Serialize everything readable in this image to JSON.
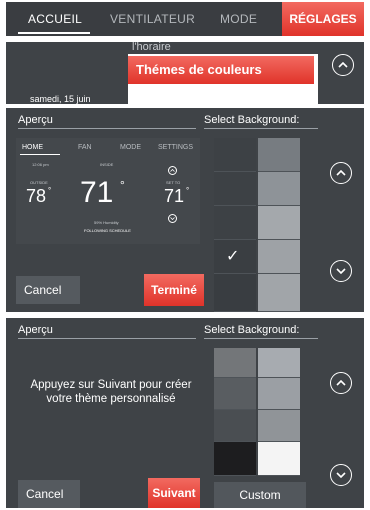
{
  "nav": {
    "tabs": [
      "ACCUEIL",
      "VENTILATEUR",
      "MODE"
    ],
    "active_tab": "ACCUEIL",
    "settings_label": "RÉGLAGES"
  },
  "settings_menu": {
    "faded_item": "l'horaire",
    "highlighted_item": "Thémes de couleurs",
    "date": "samedi, 15 juin"
  },
  "preview_screen": {
    "title": "Aperçu",
    "select_title": "Select Background:",
    "preview": {
      "tabs": [
        "HOME",
        "FAN",
        "MODE",
        "SETTINGS"
      ],
      "time": "12:06 pm",
      "inside_label": "INSIDE",
      "outside_label": "OUTSIDE",
      "outside_temp": "78",
      "inside_temp": "71",
      "set_to_label": "SET TO",
      "set_temp": "71",
      "humidity": "59% Humidity",
      "schedule": "FOLLOWING SCHEDULE",
      "degree": "°"
    },
    "cancel_label": "Cancel",
    "done_label": "Terminé",
    "checkmark": "✓",
    "left_swatches": [
      "#3d4145",
      "#3d4145",
      "#3d4145",
      "#3a3e42",
      "#393d41"
    ],
    "right_swatches": [
      "#777c81",
      "#8e9398",
      "#a4a8ac",
      "#9ea2a6",
      "#a1a5a9"
    ],
    "selected_index": 3
  },
  "custom_screen": {
    "title": "Aperçu",
    "select_title": "Select Background:",
    "message": "Appuyez sur Suivant pour créer votre thème personnalisé",
    "cancel_label": "Cancel",
    "next_label": "Suivant",
    "custom_label": "Custom",
    "left_swatches": [
      "#737679",
      "#595d61",
      "#4a4e52",
      "#1d1d1f"
    ],
    "right_swatches": [
      "#a7abb0",
      "#9b9fa4",
      "#909498",
      "#f4f4f4"
    ]
  }
}
